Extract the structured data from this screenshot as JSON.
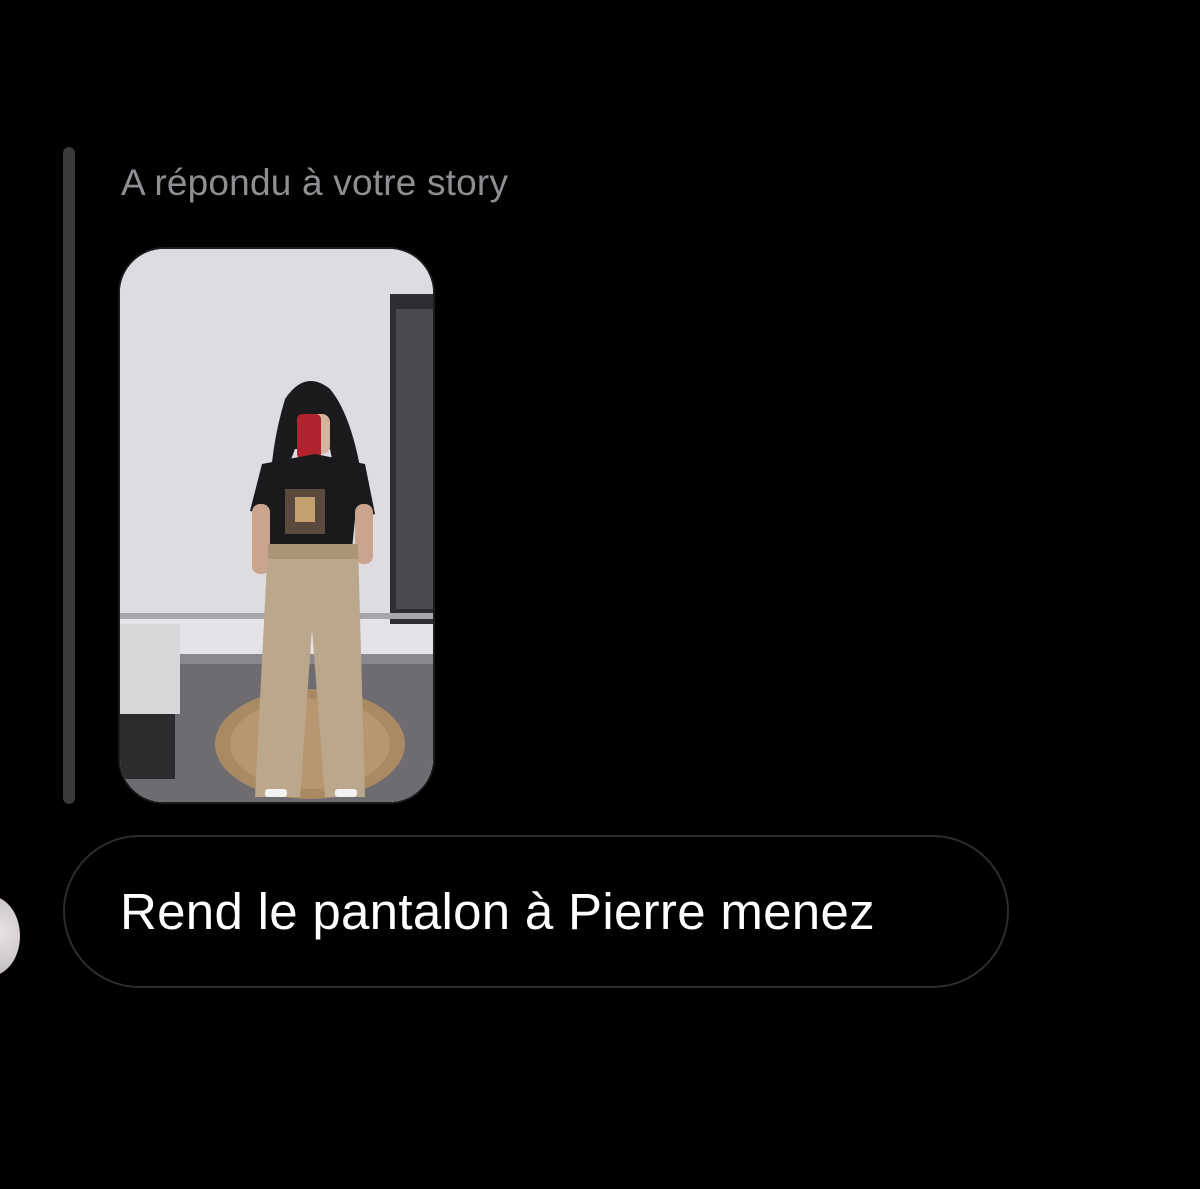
{
  "reply": {
    "caption": "A répondu à votre story"
  },
  "story": {
    "thumbnail": "story-photo"
  },
  "message": {
    "text": "Rend le pantalon à Pierre menez"
  },
  "colors": {
    "background": "#000000",
    "caption": "#8e8e93",
    "message_text": "#ffffff",
    "bubble_border": "#2c2c2e",
    "reply_bar": "#3a3a3c"
  }
}
